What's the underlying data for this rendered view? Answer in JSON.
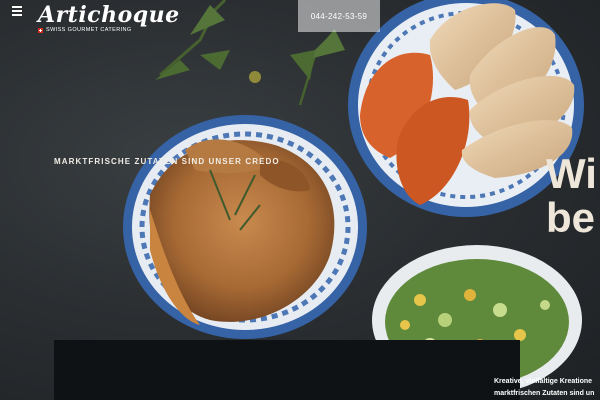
{
  "header": {
    "logo_text": "Artichoque",
    "logo_tagline": "Swiss Gourmet Catering",
    "phone": "044-242-53-59"
  },
  "hero": {
    "eyebrow": "Marktfrische Zutaten sind unser Credo",
    "heading_line1": "Wi",
    "heading_line2": "be",
    "desc_line1": "Kreative, vielfältige Kreatione",
    "desc_line2": "marktfrischen Zutaten sind un"
  },
  "icons": {
    "menu": "hamburger-menu-icon",
    "flag": "swiss-flag-icon"
  },
  "colors": {
    "background": "#24282b",
    "accent_text": "#efe6da",
    "panel": "#0e1215",
    "plate_blue": "#2f5fa0"
  }
}
